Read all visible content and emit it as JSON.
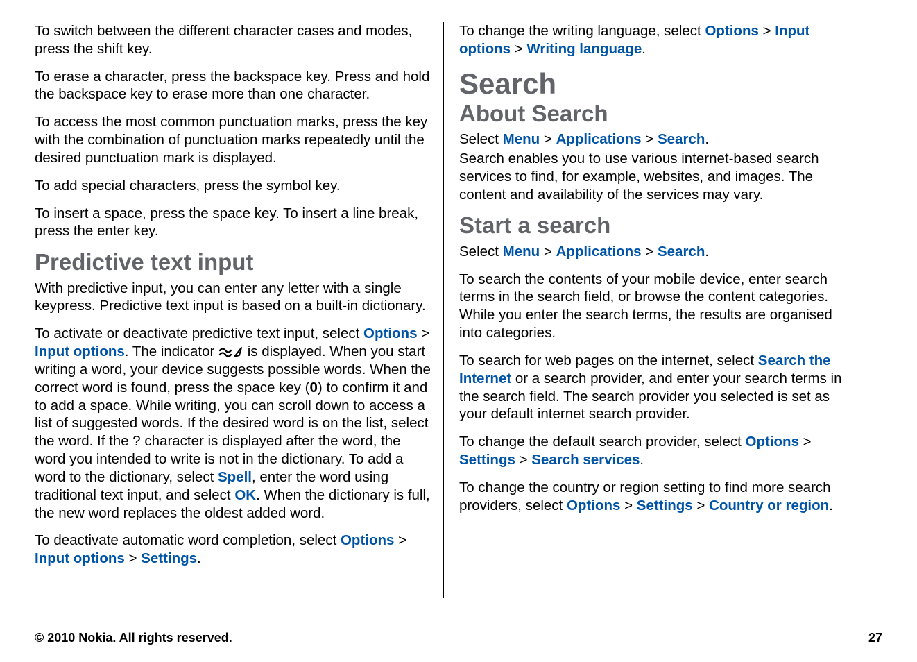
{
  "left": {
    "p1": "To switch between the different character cases and modes, press the shift key.",
    "p2": "To erase a character, press the backspace key. Press and hold the backspace key to erase more than one character.",
    "p3": "To access the most common punctuation marks, press the key with the combination of punctuation marks repeatedly until the desired punctuation mark is displayed.",
    "p4": "To add special characters, press the symbol key.",
    "p5": "To insert a space, press the space key. To insert a line break, press the enter key.",
    "h2": "Predictive text input",
    "p6": "With predictive input, you can enter any letter with a single keypress. Predictive text input is based on a built-in dictionary.",
    "p7a": "To activate or deactivate predictive text input, select ",
    "p7_link1": "Options",
    "p7_sep1": " > ",
    "p7_link2": "Input options",
    "p7b": ". The indicator ",
    "p7c": " is displayed. When you start writing a word, your device suggests possible words. When the correct word is found, press the space key (",
    "p7_bold_zero": "0",
    "p7d": ") to confirm it and to add a space. While writing, you can scroll down to access a list of suggested words. If the desired word is on the list, select the word. If the ? character is displayed after the word, the word you intended to write is not in the dictionary. To add a word to the dictionary, select ",
    "p7_link3": "Spell",
    "p7e": ", enter the word using traditional text input, and select ",
    "p7_link4": "OK",
    "p7f": ". When the dictionary is full, the new word replaces the oldest added word.",
    "p8a": "To deactivate automatic word completion, select ",
    "p8_link1": "Options",
    "p8_sep1": " > ",
    "p8_link2": "Input options",
    "p8_sep2": " > ",
    "p8_link3": "Settings",
    "p8b": "."
  },
  "right": {
    "p1a": "To change the writing language, select ",
    "p1_link1": "Options",
    "p1_sep1": " > ",
    "p1_link2": "Input options",
    "p1_sep2": " > ",
    "p1_link3": "Writing language",
    "p1b": ".",
    "h1": "Search",
    "h2a": "About Search",
    "p2a": "Select ",
    "p2_link1": "Menu",
    "p2_sep1": " > ",
    "p2_link2": "Applications",
    "p2_sep2": " > ",
    "p2_link3": "Search",
    "p2b": ".",
    "p3": "Search enables you to use various internet-based search services to find, for example, websites, and images. The content and availability of the services may vary.",
    "h2b": "Start a search",
    "p4a": "Select ",
    "p4_link1": "Menu",
    "p4_sep1": " > ",
    "p4_link2": "Applications",
    "p4_sep2": " > ",
    "p4_link3": "Search",
    "p4b": ".",
    "p5": "To search the contents of your mobile device, enter search terms in the search field, or browse the content categories. While you enter the search terms, the results are organised into categories.",
    "p6a": "To search for web pages on the internet, select ",
    "p6_link1": "Search the Internet",
    "p6b": " or a search provider, and enter your search terms in the search field. The search provider you selected is set as your default internet search provider.",
    "p7a": "To change the default search provider, select ",
    "p7_link1": "Options",
    "p7_sep1": " > ",
    "p7_link2": "Settings",
    "p7_sep2": " > ",
    "p7_link3": "Search services",
    "p7b": ".",
    "p8a": "To change the country or region setting to find more search providers, select ",
    "p8_link1": "Options",
    "p8_sep1": " > ",
    "p8_link2": "Settings",
    "p8_sep2": " > ",
    "p8_link3": "Country or region",
    "p8b": "."
  },
  "footer": {
    "copyright": "© 2010 Nokia. All rights reserved.",
    "page": "27"
  }
}
